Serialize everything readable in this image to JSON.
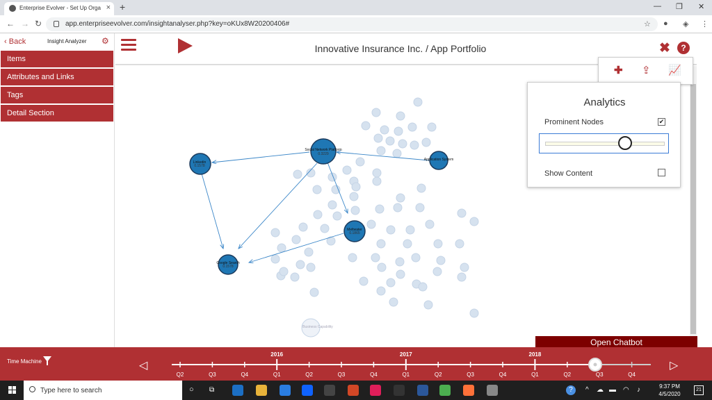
{
  "browser": {
    "tab_title": "Enterprise Evolver - Set Up Orga",
    "url": "app.enterpriseevolver.com/insightanalyser.php?key=oKUx8W20200406#"
  },
  "sidebar": {
    "back_label": "Back",
    "title": "Insight Analyzer",
    "items": [
      {
        "label": "Items"
      },
      {
        "label": "Attributes and Links"
      },
      {
        "label": "Tags"
      },
      {
        "label": "Detail Section"
      }
    ]
  },
  "header": {
    "title": "Innovative Insurance Inc. / App Portfolio"
  },
  "analytics": {
    "title": "Analytics",
    "prominent_nodes_label": "Prominent Nodes",
    "prominent_nodes_checked": true,
    "slider_value": 0.67,
    "show_content_label": "Show Content",
    "show_content_checked": false
  },
  "graph": {
    "main_nodes": [
      {
        "id": "snp",
        "label": "Social Network Platform",
        "score": "0.3229"
      },
      {
        "id": "app",
        "label": "Application System",
        "score": ""
      },
      {
        "id": "lnk",
        "label": "Linkedin",
        "score": "0.1578"
      },
      {
        "id": "mw",
        "label": "Meltwater",
        "score": "0.1865"
      },
      {
        "id": "gs",
        "label": "Google Search",
        "score": "0.1578"
      }
    ],
    "faded_label_example": "Business Capability"
  },
  "chatbot": {
    "label": "Open Chatbot"
  },
  "timeline": {
    "label": "Time Machine",
    "years": [
      "2016",
      "2017",
      "2018"
    ],
    "quarters": [
      "Q2",
      "Q3",
      "Q4",
      "Q1",
      "Q2",
      "Q3",
      "Q4",
      "Q1",
      "Q2",
      "Q3",
      "Q4",
      "Q1",
      "Q2",
      "Q3",
      "Q4"
    ]
  },
  "taskbar": {
    "search_placeholder": "Type here to search",
    "time": "9:37 PM",
    "date": "4/5/2020",
    "notifications": "21"
  },
  "colors": {
    "brand": "#b03033",
    "node_fill": "#1f77b4",
    "node_faded": "#d6e2ef"
  }
}
